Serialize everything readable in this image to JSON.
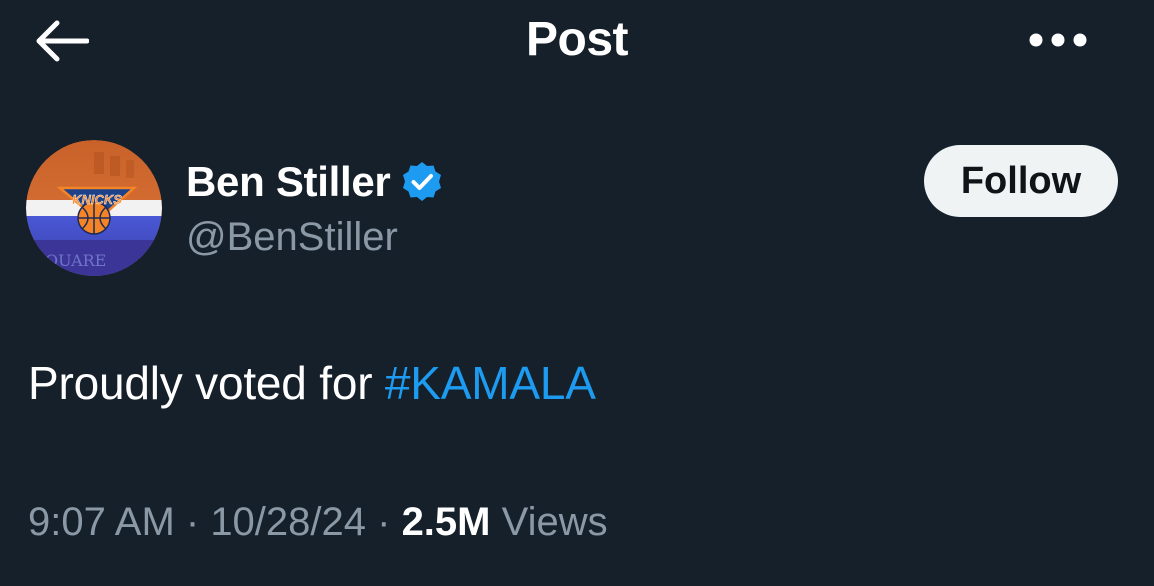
{
  "header": {
    "title": "Post",
    "back_icon": "arrow-left-icon",
    "more_icon": "more-horizontal-icon"
  },
  "author": {
    "name": "Ben Stiller",
    "handle": "@BenStiller",
    "verified_icon": "verified-badge-icon",
    "avatar_image": "New York Knicks logo avatar",
    "avatar_text": "SQUARE",
    "follow_label": "Follow"
  },
  "tweet": {
    "text": "Proudly voted for ",
    "hashtag": "#KAMALA"
  },
  "meta": {
    "time": "9:07 AM",
    "separator1": " · ",
    "date": "10/28/24",
    "separator2": " · ",
    "views_count": "2.5M",
    "views_label": " Views"
  },
  "colors": {
    "background": "#15202b",
    "text": "#ffffff",
    "secondary": "#8b98a5",
    "accent": "#1d9bf0",
    "follow_bg": "#eff3f4",
    "follow_text": "#0f1419"
  }
}
